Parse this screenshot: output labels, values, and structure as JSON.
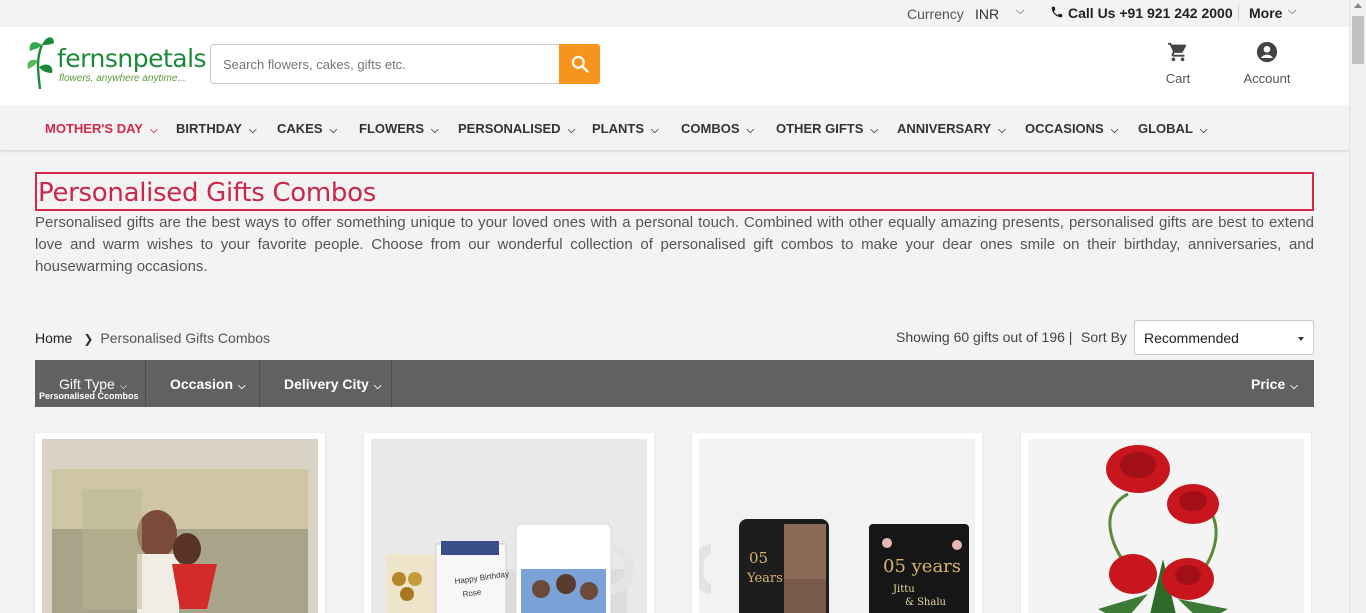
{
  "topbar": {
    "currency_label": "Currency",
    "currency_value": "INR",
    "call_text": "Call Us +91 921 242 2000",
    "more_label": "More"
  },
  "header": {
    "logo_text": "fernsnpetals",
    "logo_tagline": "flowers, anywhere anytime...",
    "search_placeholder": "Search flowers, cakes, gifts etc.",
    "cart_label": "Cart",
    "account_label": "Account"
  },
  "nav": {
    "items": [
      {
        "label": "MOTHER'S DAY"
      },
      {
        "label": "BIRTHDAY"
      },
      {
        "label": "CAKES"
      },
      {
        "label": "FLOWERS"
      },
      {
        "label": "PERSONALISED"
      },
      {
        "label": "PLANTS"
      },
      {
        "label": "COMBOS"
      },
      {
        "label": "OTHER GIFTS"
      },
      {
        "label": "ANNIVERSARY"
      },
      {
        "label": "OCCASIONS"
      },
      {
        "label": "GLOBAL"
      }
    ]
  },
  "page": {
    "title": "Personalised Gifts Combos",
    "description": "Personalised gifts are the best ways to offer something unique to your loved ones with a personal touch. Combined with other equally amazing presents, personalised gifts are best to extend love and warm wishes to your favorite people. Choose from our wonderful collection of personalised gift combos to make your dear ones smile on their birthday, anniversaries, and housewarming occasions."
  },
  "breadcrumb": {
    "home": "Home",
    "current": "Personalised Gifts Combos"
  },
  "listing": {
    "showing_text": "Showing 60 gifts out of 196 |",
    "sort_label": "Sort By",
    "sort_value": "Recommended"
  },
  "filters": {
    "gift_type": "Gift Type",
    "gift_type_selected": "Personalised Ccombos",
    "occasion": "Occasion",
    "delivery_city": "Delivery City",
    "price": "Price"
  },
  "products_image_text": {
    "card2_label": "Happy Birthday Rose",
    "card3_mug": "05 Years",
    "card3_frame": "05 years",
    "card3_names": "Jittu & Shalu"
  },
  "colors": {
    "brand_red": "#d4294a",
    "search_orange": "#f7941d",
    "filter_bar": "#616161",
    "logo_green": "#1d8a3a"
  }
}
